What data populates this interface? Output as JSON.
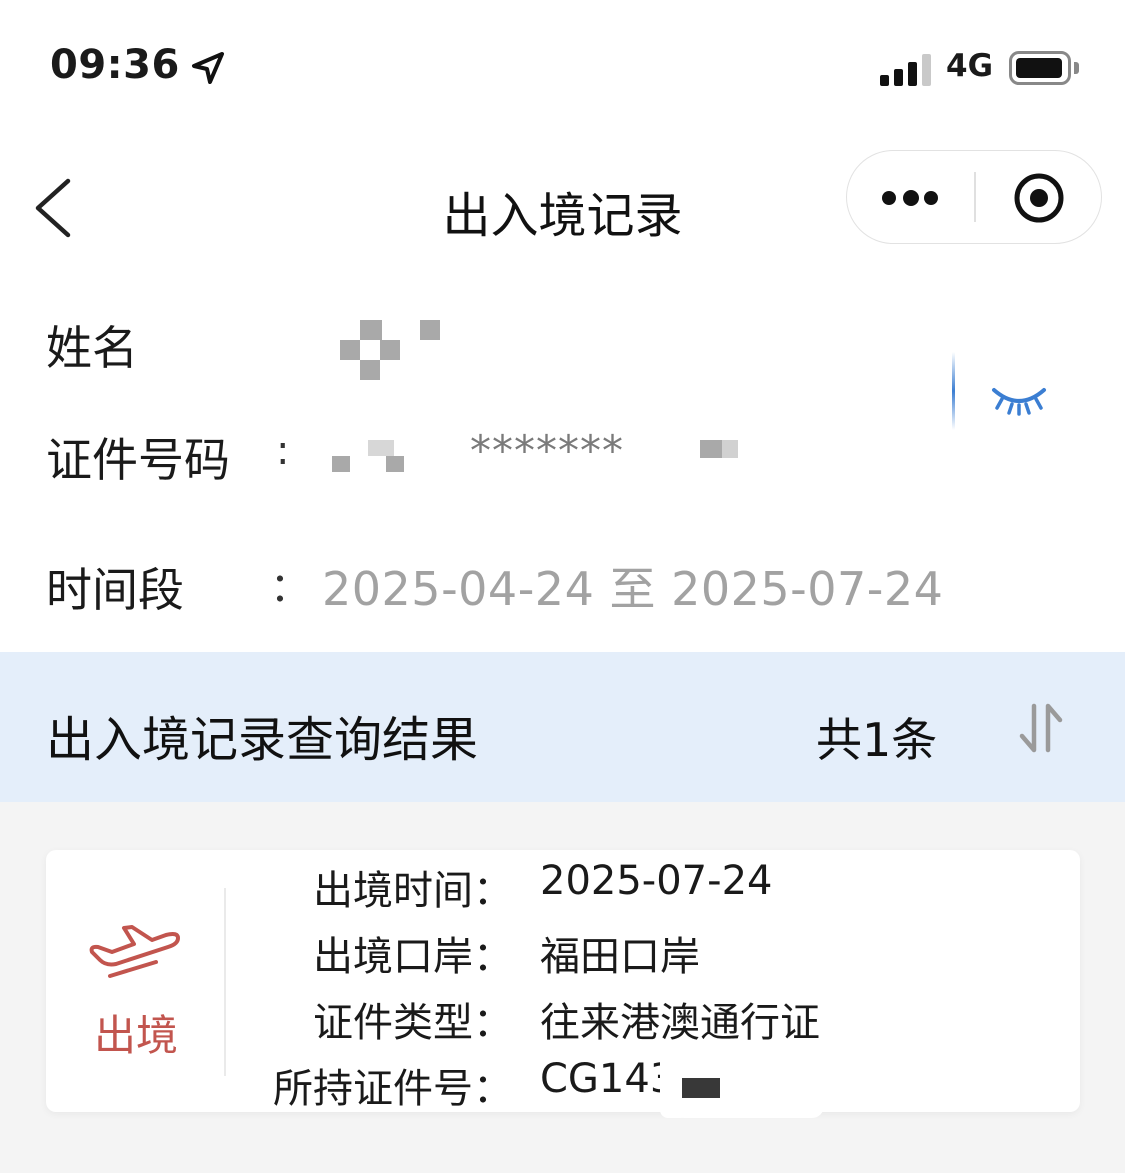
{
  "status_bar": {
    "time": "09:36",
    "network": "4G"
  },
  "nav": {
    "title": "出入境记录",
    "icons": [
      "back-arrow-icon",
      "more-dots-icon",
      "close-target-icon"
    ]
  },
  "identity": {
    "name_label": "姓名",
    "id_label": "证件号码",
    "id_colon": ":",
    "id_value_visible": "*******",
    "toggle_icon": "eye-closed-icon"
  },
  "period": {
    "label": "时间段",
    "colon": "：",
    "value": "2025-04-24 至 2025-07-24"
  },
  "results": {
    "title": "出入境记录查询结果",
    "count": "共1条",
    "sort_icon": "sort-icon",
    "records": [
      {
        "type": "出境",
        "icon": "airplane-departure-icon",
        "rows": [
          {
            "label": "出境时间：",
            "value": "2025-07-24"
          },
          {
            "label": "出境口岸：",
            "value": "福田口岸"
          },
          {
            "label": "证件类型：",
            "value": "往来港澳通行证"
          },
          {
            "label": "所持证件号：",
            "value": "CG143"
          }
        ]
      }
    ]
  },
  "colors": {
    "header_band": "#e4eefa",
    "eye_icon": "#3b7ed2",
    "departure_accent": "#c2554e",
    "placeholder_gray": "#a2a2a2"
  }
}
